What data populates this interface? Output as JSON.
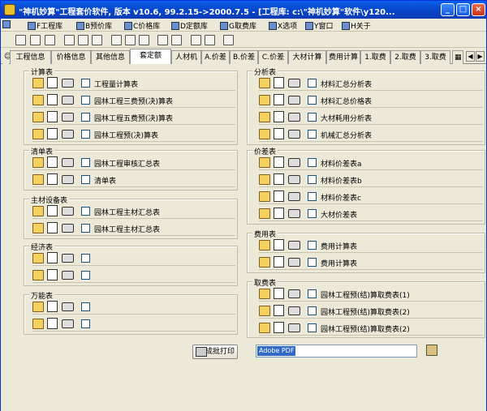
{
  "window": {
    "title": "\"神机妙算\"工程套价软件, 版本 v10.6, 99.2.15->2000.7.5 - [工程库: c:\\\"神机妙算\"软件\\y120..."
  },
  "menu": [
    "F工程库",
    "B预价库",
    "C价格库",
    "D定额库",
    "G取费库",
    "X选项",
    "Y窗口",
    "H关于"
  ],
  "tabs": [
    "工程信息",
    "价格信息",
    "其他信息",
    "套定额",
    "人材机",
    "A.价差",
    "B.价差",
    "C.价差",
    "大材计算",
    "费用计算",
    "1.取费",
    "2.取费",
    "3.取费"
  ],
  "active_tab": 3,
  "groups": {
    "calc": {
      "title": "计算表",
      "rows": [
        "工程量计算表",
        "园林工程三费预(决)算表",
        "园林工程五费预(决)算表",
        "园林工程预(决)算表"
      ]
    },
    "list": {
      "title": "清单表",
      "rows": [
        "园林工程审核汇总表",
        "清单表"
      ]
    },
    "material": {
      "title": "主材设备表",
      "rows": [
        "园林工程主材汇总表",
        "园林工程主材汇总表"
      ]
    },
    "contract": {
      "title": "经济表",
      "rows": [
        "",
        ""
      ]
    },
    "universal": {
      "title": "万能表",
      "rows": [
        "",
        ""
      ]
    },
    "analysis": {
      "title": "分析表",
      "rows": [
        "材料汇总分析表",
        "材料汇总价格表",
        "大材耗用分析表",
        "机械汇总分析表"
      ]
    },
    "pricediff": {
      "title": "价差表",
      "rows": [
        "材料价差表a",
        "材料价差表b",
        "材料价差表c",
        "大材价差表"
      ]
    },
    "fee": {
      "title": "费用表",
      "rows": [
        "费用计算表",
        "费用计算表"
      ]
    },
    "charge": {
      "title": "取费表",
      "rows": [
        "园林工程预(结)算取费表(1)",
        "园林工程预(结)算取费表(2)",
        "园林工程预(结)算取费表(2)"
      ]
    }
  },
  "batch_print_label": "成批打印",
  "printer_value": "Adobe PDF"
}
